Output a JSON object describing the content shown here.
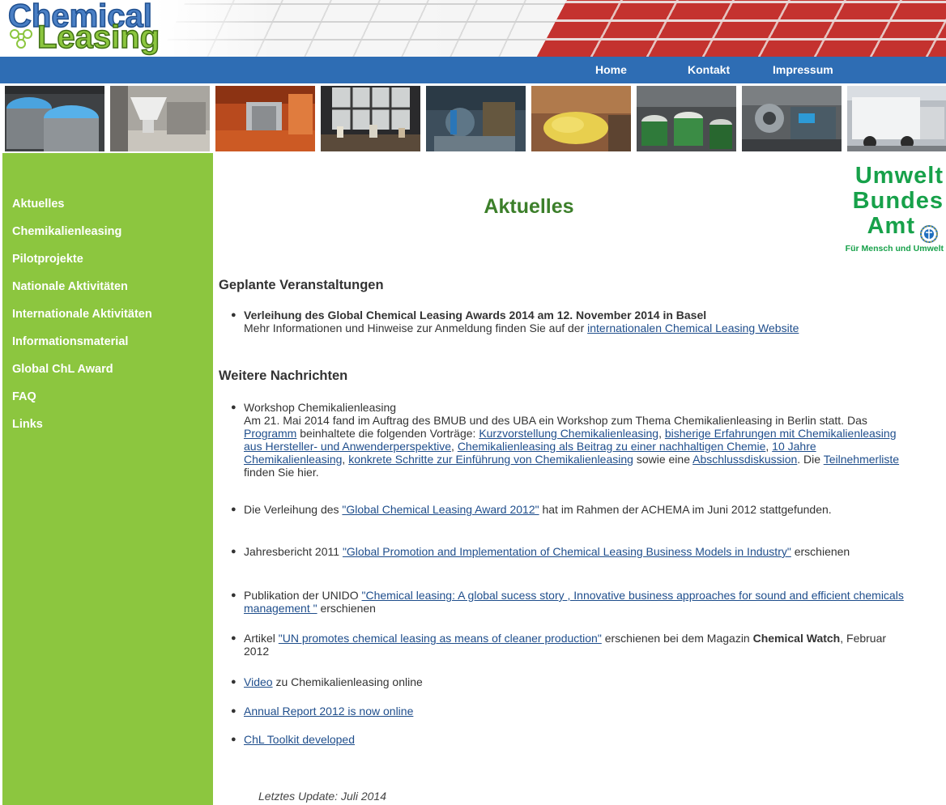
{
  "header": {
    "logo_line1": "Chemical",
    "logo_line2": "Leasing"
  },
  "topnav": {
    "items": [
      {
        "label": "Home"
      },
      {
        "label": "Kontakt"
      },
      {
        "label": "Impressum"
      }
    ]
  },
  "sidebar": {
    "items": [
      {
        "label": "Aktuelles"
      },
      {
        "label": "Chemikalienleasing"
      },
      {
        "label": "Pilotprojekte"
      },
      {
        "label": "Nationale Aktivitäten"
      },
      {
        "label": "Internationale Aktivitäten"
      },
      {
        "label": "Informationsmaterial"
      },
      {
        "label": "Global ChL Award"
      },
      {
        "label": "FAQ"
      },
      {
        "label": "Links"
      }
    ]
  },
  "uba_logo": {
    "line1": "Umwelt",
    "line2": "Bundes",
    "line3": "Amt",
    "tagline": "Für Mensch und Umwelt"
  },
  "main": {
    "title": "Aktuelles",
    "section1": "Geplante Veranstaltungen",
    "section2": "Weitere Nachrichten",
    "planned": {
      "headline": "Verleihung des Global Chemical Leasing Awards 2014 am 12. November 2014 in Basel",
      "text": "Mehr Informationen und Hinweise zur Anmeldung finden Sie auf der ",
      "link": "internationalen Chemical Leasing Website"
    },
    "news": [
      {
        "t0": "Workshop Chemikalienleasing",
        "t1": "Am 21. Mai 2014 fand im Auftrag des BMUB und des UBA ein Workshop zum Thema Chemikalienleasing in Berlin statt. Das ",
        "l1": "Programm",
        "t2": " beinhaltete die folgenden Vorträge: ",
        "l2": "Kurzvorstellung Chemikalienleasing",
        "t3": ", ",
        "l3": "bisherige Erfahrungen mit Chemikalienleasing aus Hersteller- und Anwenderperspektive",
        "t4": ", ",
        "l4": "Chemikalienleasing als Beitrag zu einer nachhaltigen Chemie",
        "t5": ", ",
        "l5": "10 Jahre Chemikalienleasing",
        "t6": ", ",
        "l6": "konkrete Schritte zur Einführung von Chemikalienleasing",
        "t7": " sowie eine ",
        "l7": "Abschlussdiskussion",
        "t8": ". Die ",
        "l8": "Teilnehmerliste",
        "t9": " finden Sie hier."
      },
      {
        "t1": "Die Verleihung des ",
        "l1": "\"Global Chemical Leasing Award 2012\"",
        "t2": " hat im Rahmen der ACHEMA im Juni 2012 stattgefunden."
      },
      {
        "t1": "Jahresbericht 2011 ",
        "l1": "\"Global Promotion and Implementation of Chemical Leasing Business Models in Industry\"",
        "t2": " erschienen"
      },
      {
        "t1": "Publikation der UNIDO ",
        "l1": "\"Chemical leasing: A global sucess story , Innovative business approaches for sound and efficient chemicals management \"",
        "t2": " erschienen"
      },
      {
        "t1": "Artikel ",
        "l1": "\"UN promotes chemical leasing as means of cleaner production\"",
        "t2": " erschienen bei dem Magazin ",
        "b1": "Chemical Watch",
        "t3": ", Februar 2012"
      },
      {
        "l1": "Video",
        "t2": " zu Chemikalienleasing online"
      },
      {
        "l1": "Annual Report 2012 is now online"
      },
      {
        "l1": "ChL Toolkit developed"
      }
    ],
    "last_update": "Letztes Update: Juli 2014"
  },
  "colors": {
    "nav_blue": "#2e6db4",
    "sidebar_green": "#8cc63f",
    "title_green": "#3c7f2a",
    "link_blue": "#1f4e8c",
    "uba_green": "#17a14a"
  }
}
